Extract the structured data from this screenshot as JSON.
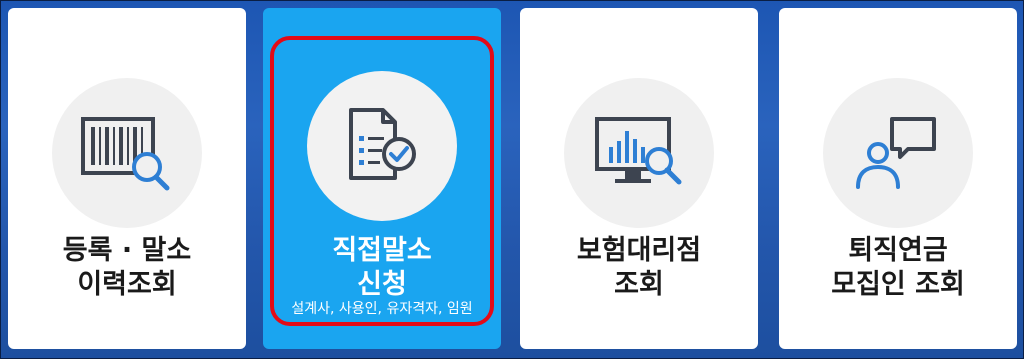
{
  "cards": [
    {
      "title_line1": "등록 · 말소",
      "title_line2": "이력조회",
      "icon": "barcode-search-icon"
    },
    {
      "title_line1": "직접말소",
      "title_line2": "신청",
      "subtitle": "설계사, 사용인, 유자격자, 임원",
      "icon": "document-check-icon",
      "accent": "#1aa5f0",
      "highlight": "#e30a17"
    },
    {
      "title_line1": "보험대리점",
      "title_line2": "조회",
      "icon": "monitor-chart-search-icon"
    },
    {
      "title_line1": "퇴직연금",
      "title_line2": "모집인 조회",
      "icon": "person-chat-icon"
    }
  ],
  "colors": {
    "background": "#2356ab",
    "icon_dark": "#3d4450",
    "icon_blue": "#2e7fd4"
  }
}
